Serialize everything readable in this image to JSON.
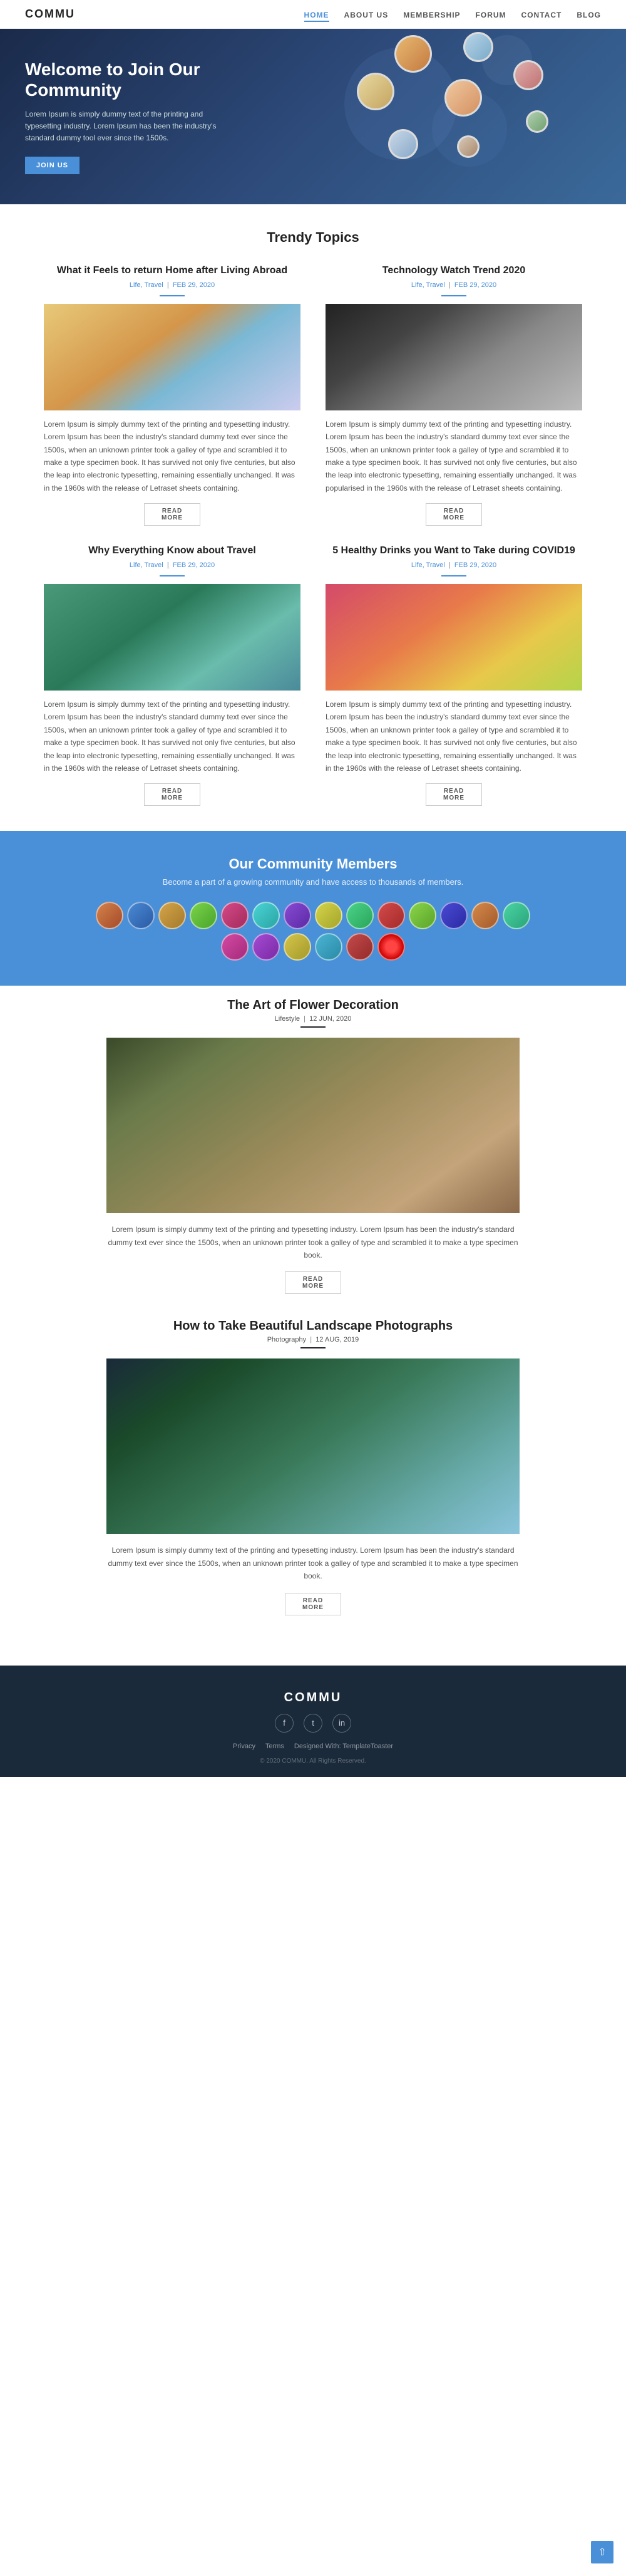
{
  "site": {
    "logo": "COMMU"
  },
  "nav": {
    "links": [
      {
        "label": "HOME",
        "active": true
      },
      {
        "label": "ABOUT US",
        "active": false
      },
      {
        "label": "MEMBERSHIP",
        "active": false
      },
      {
        "label": "FORUM",
        "active": false
      },
      {
        "label": "CONTACT",
        "active": false
      },
      {
        "label": "BLOG",
        "active": false
      }
    ]
  },
  "hero": {
    "title": "Welcome to Join Our Community",
    "text": "Lorem Ipsum is simply dummy text of the printing and typesetting industry. Lorem Ipsum has been the industry's standard dummy tool ever since the 1500s.",
    "btn_label": "JOIN US"
  },
  "trendy": {
    "section_title": "Trendy Topics",
    "topics": [
      {
        "title": "What it Feels to return Home after Living Abroad",
        "meta_category": "Life, Travel",
        "meta_date": "FEB 29, 2020",
        "text": "Lorem Ipsum is simply dummy text of the printing and typesetting industry. Lorem Ipsum has been the industry's standard dummy text ever since the 1500s, when an unknown printer took a galley of type and scrambled it to make a type specimen book. It has survived not only five centuries, but also the leap into electronic typesetting, remaining essentially unchanged. It was in the 1960s with the release of Letraset sheets containing.",
        "img_class": "img-woman-travel",
        "read_more": "READ MORE"
      },
      {
        "title": "Technology Watch Trend 2020",
        "meta_category": "Life, Travel",
        "meta_date": "FEB 29, 2020",
        "text": "Lorem Ipsum is simply dummy text of the printing and typesetting industry. Lorem Ipsum has been the industry's standard dummy text ever since the 1500s, when an unknown printer took a galley of type and scrambled it to make a type specimen book. It has survived not only five centuries, but also the leap into electronic typesetting, remaining essentially unchanged. It was popularised in the 1960s with the release of Letraset sheets containing.",
        "img_class": "img-tech-watch",
        "read_more": "READ MORE"
      },
      {
        "title": "Why Everything Know about Travel",
        "meta_category": "Life, Travel",
        "meta_date": "FEB 29, 2020",
        "text": "Lorem Ipsum is simply dummy text of the printing and typesetting industry. Lorem Ipsum has been the industry's standard dummy text ever since the 1500s, when an unknown printer took a galley of type and scrambled it to make a type specimen book. It has survived not only five centuries, but also the leap into electronic typesetting, remaining essentially unchanged. It was in the 1960s with the release of Letraset sheets containing.",
        "img_class": "img-aerial-travel",
        "read_more": "READ MORE"
      },
      {
        "title": "5 Healthy Drinks you Want to Take during COVID19",
        "meta_category": "Life, Travel",
        "meta_date": "FEB 29, 2020",
        "text": "Lorem Ipsum is simply dummy text of the printing and typesetting industry. Lorem Ipsum has been the industry's standard dummy text ever since the 1500s, when an unknown printer took a galley of type and scrambled it to make a type specimen book. It has survived not only five centuries, but also the leap into electronic typesetting, remaining essentially unchanged. It was in the 1960s with the release of Letraset sheets containing.",
        "img_class": "img-healthy-drink",
        "read_more": "READ MORE"
      }
    ]
  },
  "community": {
    "title": "Our Community Members",
    "subtitle": "Become a part of a growing community and have access to thousands of members.",
    "avatar_count": 20
  },
  "featured": {
    "articles": [
      {
        "title": "The Art of Flower Decoration",
        "meta_category": "Lifestyle",
        "meta_date": "12 JUN, 2020",
        "text": "Lorem Ipsum is simply dummy text of the printing and typesetting industry. Lorem Ipsum has been the industry's standard dummy text ever since the 1500s, when an unknown printer took a galley of type and scrambled it to make a type specimen book.",
        "img_class": "img-flower-large",
        "read_more": "READ MORE"
      },
      {
        "title": "How to Take Beautiful Landscape Photographs",
        "meta_category": "Photography",
        "meta_date": "12 AUG, 2019",
        "text": "Lorem Ipsum is simply dummy text of the printing and typesetting industry. Lorem Ipsum has been the industry's standard dummy text ever since the 1500s, when an unknown printer took a galley of type and scrambled it to make a type specimen book.",
        "img_class": "img-landscape-large",
        "read_more": "READ MORE"
      }
    ]
  },
  "footer": {
    "logo": "COMMU",
    "social": [
      "f",
      "t",
      "in"
    ],
    "links": [
      "Privacy",
      "Terms",
      "Designed With: TemplateToaster"
    ],
    "copyright": ""
  }
}
